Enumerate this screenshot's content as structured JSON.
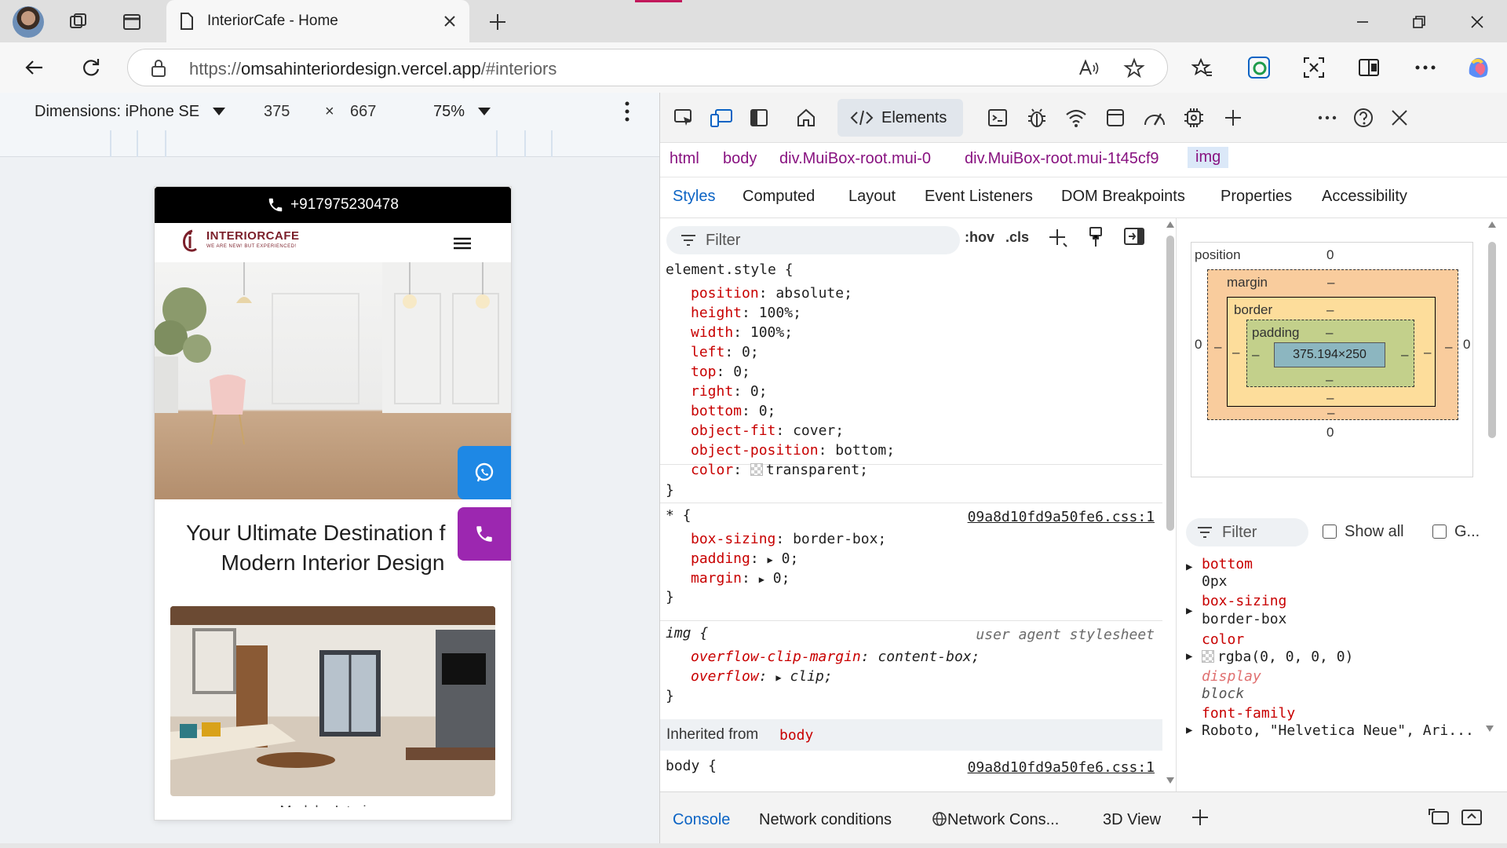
{
  "browser": {
    "tab_title": "InteriorCafe - Home",
    "url_scheme": "https://",
    "url_host": "omsahinteriordesign.vercel.app",
    "url_path": "/#interiors"
  },
  "device_toolbar": {
    "dimensions_label": "Dimensions: iPhone SE",
    "width": "375",
    "times": "×",
    "height": "667",
    "zoom": "75%"
  },
  "site": {
    "phone": "+917975230478",
    "logo_name": "INTERIORCAFE",
    "logo_tag": "WE ARE NEW! BUT EXPERIENCED!",
    "headline_line1": "Your Ultimate Destination f",
    "headline_line2": "Modern Interior Design",
    "peek_text": "Modular Interiors",
    "whatsapp_color": "#1e88e5",
    "call_color": "#9c27b0"
  },
  "devtools": {
    "elements_tab": "Elements",
    "breadcrumbs": [
      "html",
      "body",
      "div.MuiBox-root.mui-0",
      "div.MuiBox-root.mui-1t45cf9",
      "img"
    ],
    "subtabs": [
      "Styles",
      "Computed",
      "Layout",
      "Event Listeners",
      "DOM Breakpoints",
      "Properties",
      "Accessibility"
    ],
    "filter_placeholder": "Filter",
    "hov": ":hov",
    "cls": ".cls",
    "rules": {
      "element_style": {
        "selector": "element.style {",
        "decls": [
          {
            "p": "position",
            "v": "absolute;"
          },
          {
            "p": "height",
            "v": "100%;"
          },
          {
            "p": "width",
            "v": "100%;"
          },
          {
            "p": "left",
            "v": "0;"
          },
          {
            "p": "top",
            "v": "0;"
          },
          {
            "p": "right",
            "v": "0;"
          },
          {
            "p": "bottom",
            "v": "0;"
          },
          {
            "p": "object-fit",
            "v": "cover;"
          },
          {
            "p": "object-position",
            "v": "bottom;"
          },
          {
            "p": "color",
            "v": "transparent;"
          }
        ]
      },
      "universal": {
        "selector": "* {",
        "source": "09a8d10fd9a50fe6.css:1",
        "decls": [
          {
            "p": "box-sizing",
            "v": "border-box;"
          },
          {
            "p": "padding",
            "v": "0;"
          },
          {
            "p": "margin",
            "v": "0;"
          }
        ]
      },
      "img": {
        "selector": "img {",
        "source": "user agent stylesheet",
        "decls": [
          {
            "p": "overflow-clip-margin",
            "v": "content-box;"
          },
          {
            "p": "overflow",
            "v": "clip;"
          }
        ]
      },
      "close_brace": "}",
      "inherited_label": "Inherited from",
      "inherited_from": "body",
      "body_selector": "body {",
      "body_source": "09a8d10fd9a50fe6.css:1"
    },
    "box_model": {
      "position_label": "position",
      "position_value": "0",
      "margin_label": "margin",
      "border_label": "border",
      "padding_label": "padding",
      "content": "375.194×250",
      "dash": "–",
      "zero": "0"
    },
    "computed": {
      "filter_placeholder": "Filter",
      "show_all": "Show all",
      "group": "G...",
      "props": [
        {
          "name": "bottom",
          "value": "0px"
        },
        {
          "name": "box-sizing",
          "value": "border-box"
        },
        {
          "name": "color",
          "value": "rgba(0, 0, 0, 0)"
        },
        {
          "name": "display",
          "value": "block"
        },
        {
          "name": "font-family",
          "value": "Roboto, \"Helvetica Neue\", Ari..."
        }
      ]
    },
    "drawer_tabs": [
      "Console",
      "Network conditions",
      "Network Cons...",
      "3D View"
    ]
  }
}
